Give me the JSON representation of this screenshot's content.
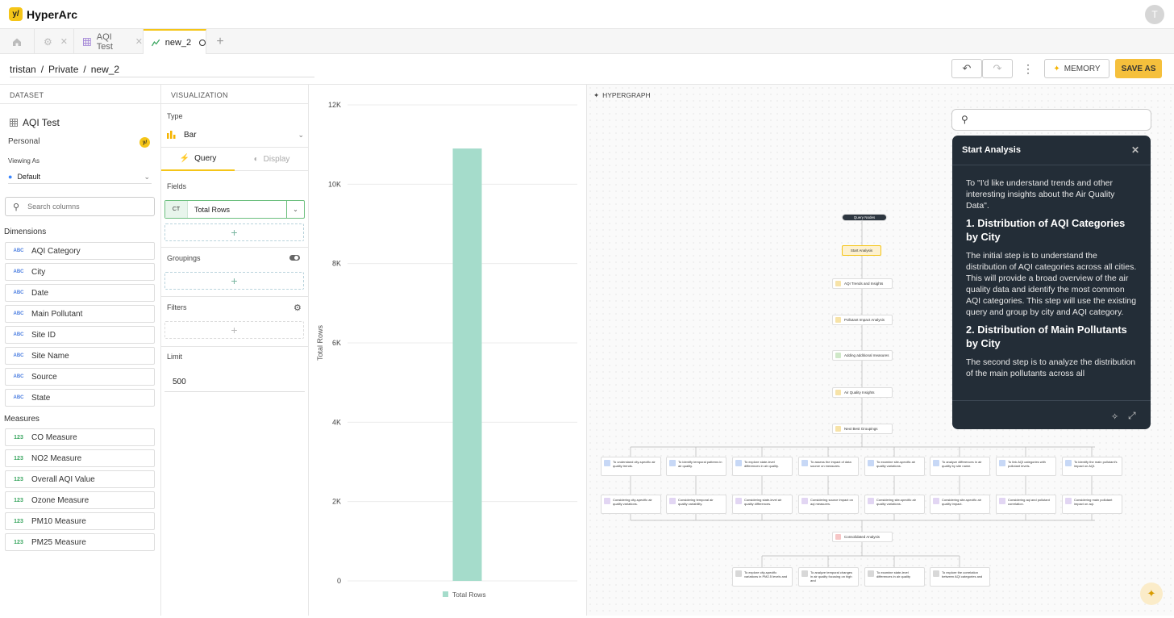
{
  "app": {
    "brand": "HyperArc",
    "avatar_initial": "T"
  },
  "tabs": [
    {
      "label": "AQI Test"
    },
    {
      "label": "new_2"
    }
  ],
  "breadcrumb": {
    "user": "tristan",
    "space": "Private",
    "name": "new_2"
  },
  "toolbar": {
    "memory_label": "MEMORY",
    "save_as_label": "SAVE AS"
  },
  "dataset": {
    "header": "DATASET",
    "name": "AQI Test",
    "owner": "Personal",
    "viewing_as_label": "Viewing As",
    "viewing_as_value": "Default",
    "search_placeholder": "Search columns",
    "dimensions_label": "Dimensions",
    "measures_label": "Measures",
    "dimensions": [
      {
        "type": "ABC",
        "name": "AQI Category"
      },
      {
        "type": "ABC",
        "name": "City"
      },
      {
        "type": "ABC",
        "name": "Date"
      },
      {
        "type": "ABC",
        "name": "Main Pollutant"
      },
      {
        "type": "ABC",
        "name": "Site ID"
      },
      {
        "type": "ABC",
        "name": "Site Name"
      },
      {
        "type": "ABC",
        "name": "Source"
      },
      {
        "type": "ABC",
        "name": "State"
      }
    ],
    "measures": [
      {
        "type": "123",
        "name": "CO Measure"
      },
      {
        "type": "123",
        "name": "NO2 Measure"
      },
      {
        "type": "123",
        "name": "Overall AQI Value"
      },
      {
        "type": "123",
        "name": "Ozone Measure"
      },
      {
        "type": "123",
        "name": "PM10 Measure"
      },
      {
        "type": "123",
        "name": "PM25 Measure"
      }
    ]
  },
  "viz": {
    "header": "VISUALIZATION",
    "type_label": "Type",
    "type_value": "Bar",
    "query_tab": "Query",
    "display_tab": "Display",
    "fields_label": "Fields",
    "field_tag": "CT",
    "field_name": "Total Rows",
    "groupings_label": "Groupings",
    "filters_label": "Filters",
    "limit_label": "Limit",
    "limit_value": "500",
    "add_glyph": "+"
  },
  "chart_data": {
    "type": "bar",
    "categories": [
      ""
    ],
    "series": [
      {
        "name": "Total Rows",
        "values": [
          10900
        ]
      }
    ],
    "ylabel": "Total Rows",
    "ylim": [
      0,
      12000
    ],
    "yticks": [
      0,
      2000,
      4000,
      6000,
      8000,
      10000,
      12000
    ],
    "ytick_labels": [
      "0",
      "2K",
      "4K",
      "6K",
      "8K",
      "10K",
      "12K"
    ],
    "legend": "bottom",
    "grid": true,
    "bar_color": "#a5dccb"
  },
  "hypergraph": {
    "header": "HYPERGRAPH",
    "root": "Query Nodes",
    "chain": [
      "Start Analysis",
      "AQI Trends and Insights",
      "Pollutant Impact Analysis",
      "Adding additional measures",
      "Air Quality Insights",
      "Next Best Groupings"
    ],
    "row1": [
      "To understand city-specific air quality trends.",
      "To identify temporal patterns in air quality.",
      "To explore state-level differences in air quality.",
      "To assess the impact of data source on measures.",
      "To examine site-specific air quality variations.",
      "To analyze differences in air quality by site name.",
      "To link AQI categories with pollutant levels.",
      "To identify the main pollutant's impact on AQI."
    ],
    "row2": [
      "Considering city-specific air quality variations.",
      "Considering temporal air quality variability.",
      "Considering state-level air quality differences.",
      "Considering source impact on aqi measures.",
      "Considering site-specific air quality variations.",
      "Considering site-specific air quality impact.",
      "Considering aqi and pollutant correlation.",
      "Considering main pollutant impact on aqi."
    ],
    "consolidated": "Consolidated Analysis",
    "row3": [
      "To explore city-specific variations in PM2.5 levels and",
      "To analyze temporal changes in air quality focusing on high and",
      "To examine state-level differences in air quality",
      "To explore the correlation between AQI categories and"
    ]
  },
  "analysis": {
    "title": "Start Analysis",
    "intro": "To \"I'd like understand trends and other interesting insights about the Air Quality Data\".",
    "h1": "1. Distribution of AQI Categories by City",
    "p1": "The initial step is to understand the distribution of AQI categories across all cities. This will provide a broad overview of the air quality data and identify the most common AQI categories. This step will use the existing query and group by city and AQI category.",
    "h2": "2. Distribution of Main Pollutants by City",
    "p2": "The second step is to analyze the distribution of the main pollutants across all"
  },
  "colors": {
    "accent": "#f5c518",
    "save": "#f5c03c",
    "modal_bg": "#232d37"
  }
}
